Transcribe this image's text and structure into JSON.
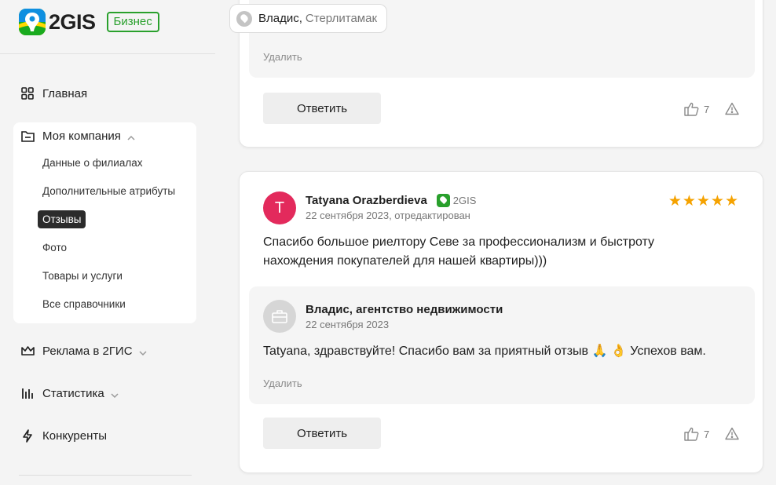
{
  "brand": {
    "logo_text": "2GIS",
    "badge": "Бизнес",
    "accent": "#29a02c"
  },
  "sidebar": {
    "items": [
      {
        "label": "Главная",
        "icon": "grid-icon"
      },
      {
        "label": "Моя компания",
        "icon": "folder-icon"
      },
      {
        "label": "Реклама в 2ГИС",
        "icon": "crown-icon"
      },
      {
        "label": "Статистика",
        "icon": "bar-chart-icon"
      },
      {
        "label": "Конкуренты",
        "icon": "lightning-icon"
      }
    ],
    "company_subitems": [
      {
        "label": "Данные о филиалах"
      },
      {
        "label": "Дополнительные атрибуты"
      },
      {
        "label": "Отзывы",
        "active": true
      },
      {
        "label": "Фото"
      },
      {
        "label": "Товары и услуги"
      },
      {
        "label": "Все справочники"
      }
    ]
  },
  "header": {
    "company": "Владис,",
    "city": "Стерлитамак"
  },
  "card1": {
    "delete_label": "Удалить",
    "answer_label": "Ответить",
    "likes": "7"
  },
  "card2": {
    "avatar_letter": "T",
    "author": "Tatyana Orazberdieva",
    "source": "2GIS",
    "date": "22 сентября 2023, отредактирован",
    "rating": "★★★★★",
    "text": "Спасибо большое риелтору Севе за профессионализм и быстроту нахождения покупателей для нашей квартиры)))",
    "reply": {
      "name": "Владис, агентство недвижимости",
      "date": "22 сентября 2023",
      "text": "Tatyana, здравствуйте! Спасибо вам за приятный отзыв 🙏 👌 Успехов вам.",
      "delete_label": "Удалить"
    },
    "answer_label": "Ответить",
    "likes": "7"
  }
}
